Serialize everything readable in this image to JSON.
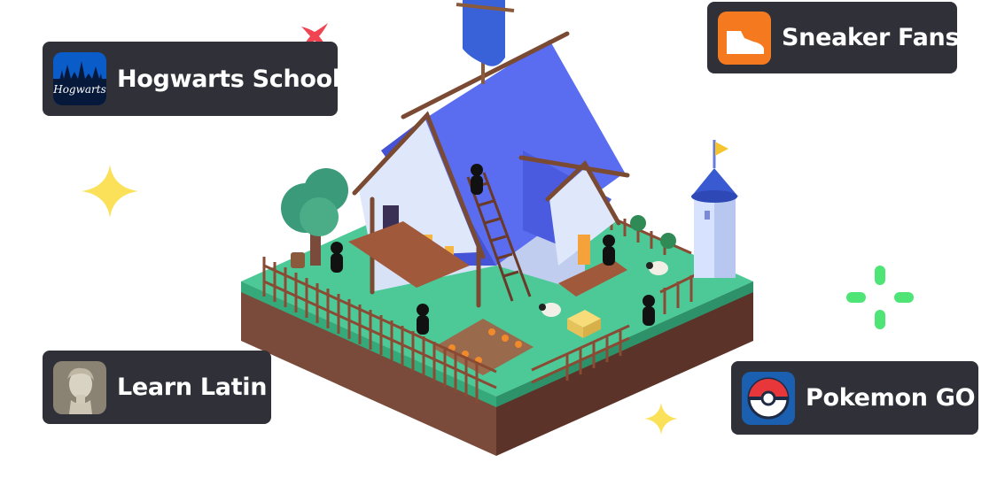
{
  "servers": {
    "hogwarts": {
      "label": "Hogwarts School",
      "icon": "hogwarts-castle-icon",
      "icon_text": "Hogwarts",
      "accent": "#0a5cc9"
    },
    "sneaker": {
      "label": "Sneaker Fans",
      "icon": "sneaker-icon",
      "accent": "#f57a1f"
    },
    "latin": {
      "label": "Learn Latin",
      "icon": "roman-bust-icon",
      "accent": "#8a8273"
    },
    "pokemon": {
      "label": "Pokemon GO",
      "icon": "pokeball-icon",
      "accent": "#1a5fb0"
    }
  },
  "colors": {
    "card_bg": "#303038",
    "card_text": "#ffffff",
    "sparkle_yellow": "#fbe15a",
    "sparkle_green": "#4ee576",
    "sparkle_red": "#f04452",
    "roof_blue": "#5a6cf0",
    "grass": "#3fc28a",
    "soil": "#7a4a3a"
  }
}
